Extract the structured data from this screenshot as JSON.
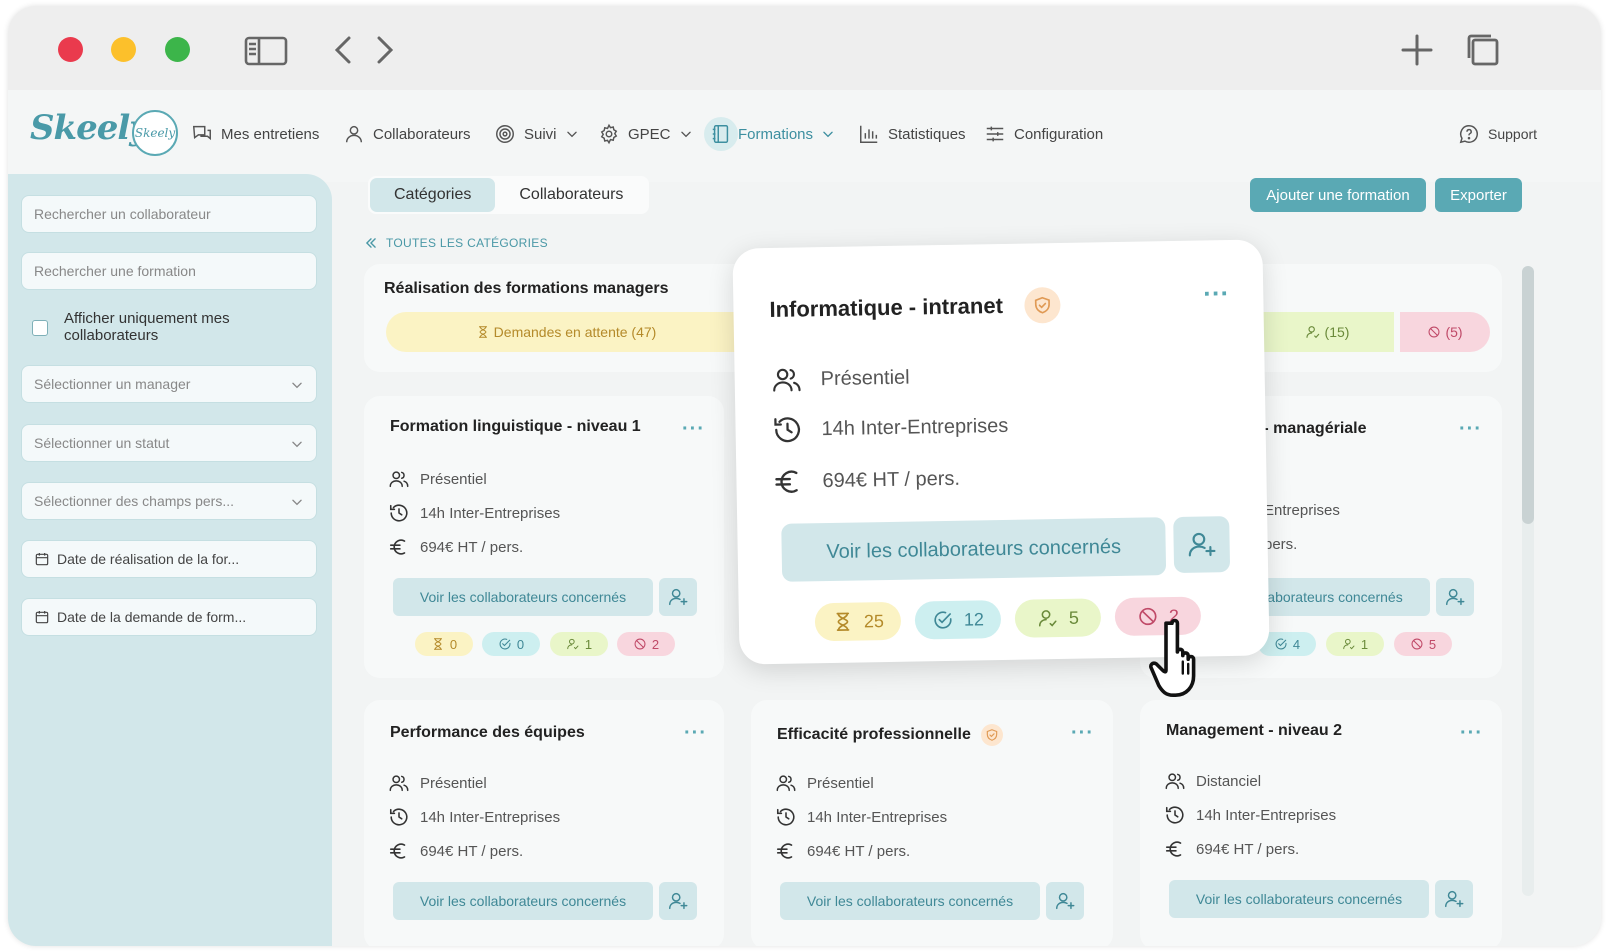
{
  "nav": {
    "items": [
      {
        "label": "Mes entretiens"
      },
      {
        "label": "Collaborateurs"
      },
      {
        "label": "Suivi"
      },
      {
        "label": "GPEC"
      },
      {
        "label": "Formations"
      },
      {
        "label": "Statistiques"
      },
      {
        "label": "Configuration"
      }
    ],
    "support": "Support",
    "logo": "Skeely",
    "logo_small": "Skeely"
  },
  "sidebar": {
    "search_collab": "Rechercher un collaborateur",
    "search_formation": "Rechercher une formation",
    "only_mine": "Afficher uniquement mes collaborateurs",
    "manager": "Sélectionner un manager",
    "statut": "Sélectionner un statut",
    "champs": "Sélectionner des champs pers...",
    "date_realisation": "Date de réalisation de la for...",
    "date_demande": "Date de la demande de form..."
  },
  "main": {
    "tabs": [
      "Catégories",
      "Collaborateurs"
    ],
    "add_button": "Ajouter une formation",
    "export_button": "Exporter",
    "breadcrumb": "TOUTES LES CATÉGORIES",
    "panel": {
      "title": "Réalisation des formations managers",
      "pending": "Demandes en attente (47)",
      "users": "(15)",
      "banned": "(5)"
    },
    "cards": [
      {
        "title": "Formation linguistique - niveau 1",
        "mode": "Présentiel",
        "duration": "14h Inter-Entreprises",
        "price": "694€ HT / pers.",
        "voir": "Voir les collaborateurs concernés",
        "counts": [
          "0",
          "0",
          "1",
          "2"
        ]
      },
      {
        "title": "e - managériale",
        "duration": "Entreprises",
        "price": "pers.",
        "voir": "aborateurs concernés",
        "counts": [
          "4",
          "1",
          "5"
        ]
      },
      {
        "title": "Performance des équipes",
        "mode": "Présentiel",
        "duration": "14h Inter-Entreprises",
        "price": "694€ HT / pers.",
        "voir": "Voir les collaborateurs concernés"
      },
      {
        "title": "Efficacité professionnelle",
        "mode": "Présentiel",
        "duration": "14h Inter-Entreprises",
        "price": "694€ HT / pers.",
        "voir": "Voir les collaborateurs concernés"
      },
      {
        "title": "Management - niveau 2",
        "mode": "Distanciel",
        "duration": "14h Inter-Entreprises",
        "price": "694€ HT / pers.",
        "voir": "Voir les collaborateurs concernés"
      }
    ]
  },
  "popup": {
    "title": "Informatique - intranet",
    "mode": "Présentiel",
    "duration": "14h Inter-Entreprises",
    "price": "694€ HT / pers.",
    "voir": "Voir les collaborateurs concernés",
    "counts": [
      "25",
      "12",
      "5",
      "2"
    ]
  },
  "colors": {
    "accent": "#5aa9b4",
    "sidebar": "#d2e7ea",
    "pending": "#fbf3c4",
    "done": "#cdeff0",
    "assigned": "#e9f6c9",
    "refused": "#f8d6de"
  }
}
